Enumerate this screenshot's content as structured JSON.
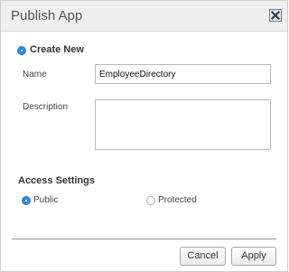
{
  "dialog": {
    "title": "Publish App",
    "close_icon": "close-icon"
  },
  "create_new": {
    "label": "Create New",
    "selected": true
  },
  "form": {
    "name_label": "Name",
    "name_value": "EmployeeDirectory",
    "description_label": "Description",
    "description_value": ""
  },
  "access": {
    "heading": "Access Settings",
    "options": [
      {
        "label": "Public",
        "selected": true
      },
      {
        "label": "Protected",
        "selected": false
      }
    ]
  },
  "buttons": {
    "cancel": "Cancel",
    "apply": "Apply"
  },
  "colors": {
    "accent": "#2f88e0",
    "titlebar": "#eeeeee"
  }
}
